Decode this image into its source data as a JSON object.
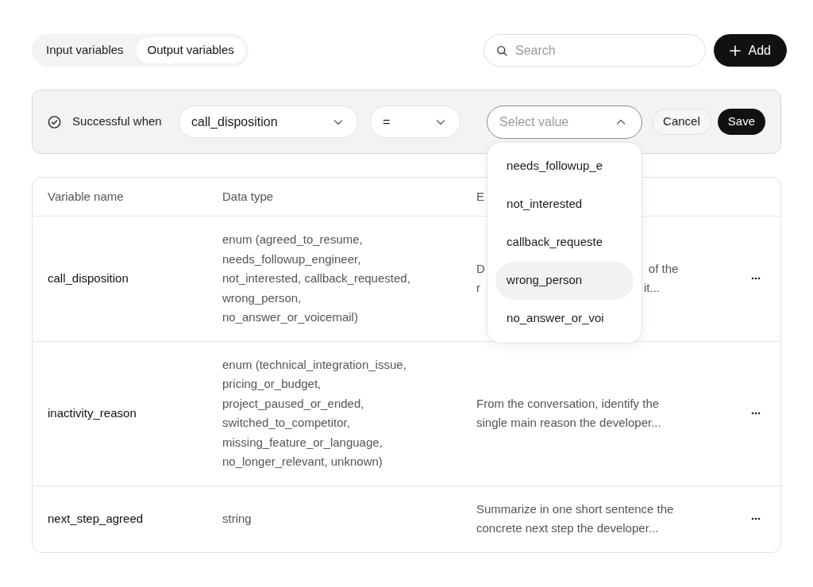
{
  "tabs": [
    {
      "label": "Input variables",
      "selected": false
    },
    {
      "label": "Output variables",
      "selected": true
    }
  ],
  "search": {
    "placeholder": "Search"
  },
  "add_button": {
    "label": "Add"
  },
  "condition": {
    "label": "Successful when",
    "variable": "call_disposition",
    "operator": "=",
    "value_placeholder": "Select value",
    "expanded": true,
    "cancel": "Cancel",
    "save": "Save"
  },
  "value_options": [
    {
      "label": "needs_followup_e",
      "selected": false
    },
    {
      "label": "not_interested",
      "selected": false
    },
    {
      "label": "callback_requeste",
      "selected": false
    },
    {
      "label": "wrong_person",
      "selected": true
    },
    {
      "label": "no_answer_or_voi",
      "selected": false
    }
  ],
  "table": {
    "columns": [
      "Variable name",
      "Data type",
      "E"
    ],
    "rows": [
      {
        "name": "call_disposition",
        "type_lines": [
          "enum (agreed_to_resume,",
          "needs_followup_engineer,",
          "not_interested, callback_requested,",
          "wrong_person,",
          "no_answer_or_voicemail)"
        ],
        "description_lines": [
          [
            "D",
            "of the"
          ],
          [
            "r",
            "it..."
          ]
        ]
      },
      {
        "name": "inactivity_reason",
        "type_lines": [
          "enum (technical_integration_issue,",
          "pricing_or_budget,",
          "project_paused_or_ended,",
          "switched_to_competitor,",
          "missing_feature_or_language,",
          "no_longer_relevant, unknown)"
        ],
        "description_lines": [
          [
            "From the conversation, identify the"
          ],
          [
            "single main reason the developer..."
          ]
        ]
      },
      {
        "name": "next_step_agreed",
        "type_lines": [
          "string"
        ],
        "description_lines": [
          [
            "Summarize in one short sentence the"
          ],
          [
            "concrete next step the developer..."
          ]
        ]
      }
    ]
  }
}
